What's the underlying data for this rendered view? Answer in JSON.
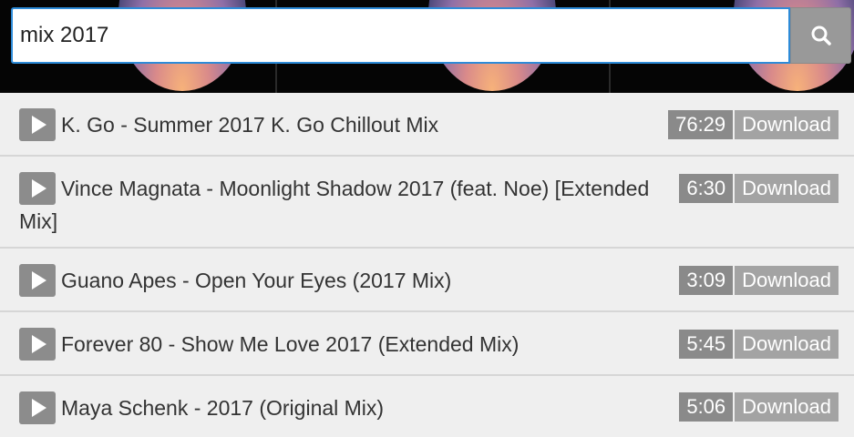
{
  "search": {
    "value": "mix 2017",
    "button_icon": "search-icon"
  },
  "tracks": [
    {
      "title": "K. Go - Summer 2017 K. Go Chillout Mix",
      "duration": "76:29",
      "download_label": "Download"
    },
    {
      "title": "Vince Magnata - Moonlight Shadow 2017 (feat. Noe) [Extended Mix]",
      "duration": "6:30",
      "download_label": "Download"
    },
    {
      "title": "Guano Apes - Open Your Eyes (2017 Mix)",
      "duration": "3:09",
      "download_label": "Download"
    },
    {
      "title": "Forever 80 - Show Me Love 2017 (Extended Mix)",
      "duration": "5:45",
      "download_label": "Download"
    },
    {
      "title": "Maya Schenk - 2017 (Original Mix)",
      "duration": "5:06",
      "download_label": "Download"
    }
  ],
  "colors": {
    "accent_border": "#2d8bd8",
    "badge_dark": "#8a8a8a",
    "badge_light": "#a3a3a3"
  }
}
